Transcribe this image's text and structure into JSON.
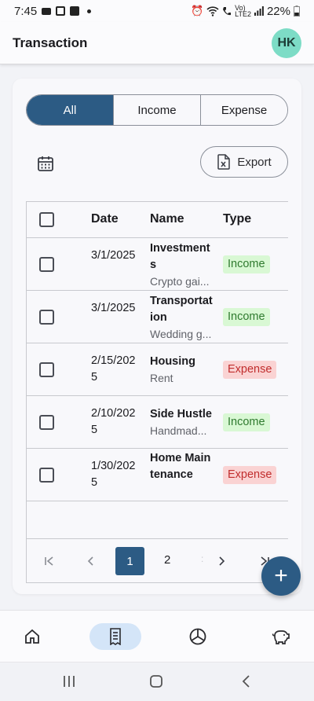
{
  "status": {
    "time": "7:45",
    "lte": "Vo)",
    "lte2": "LTE2",
    "battery": "22%"
  },
  "header": {
    "title": "Transaction",
    "avatar_initials": "HK"
  },
  "filter_tabs": [
    {
      "label": "All",
      "active": true
    },
    {
      "label": "Income",
      "active": false
    },
    {
      "label": "Expense",
      "active": false
    }
  ],
  "toolbar": {
    "calendar_icon": "calendar-icon",
    "export_label": "Export",
    "export_icon": "excel-file-icon"
  },
  "table": {
    "columns": [
      "Date",
      "Name",
      "Type"
    ],
    "rows": [
      {
        "date": "3/1/2025",
        "name": "Investments",
        "desc": "Crypto gai...",
        "type": "Income"
      },
      {
        "date": "3/1/2025",
        "name": "Transportation",
        "desc": "Wedding g...",
        "type": "Income"
      },
      {
        "date": "2/15/2025",
        "name": "Housing",
        "desc": "Rent",
        "type": "Expense"
      },
      {
        "date": "2/10/2025",
        "name": "Side Hustle",
        "desc": "Handmad...",
        "type": "Income"
      },
      {
        "date": "1/30/2025",
        "name": "Home Maintenance",
        "desc": "",
        "type": "Expense"
      }
    ]
  },
  "pagination": {
    "current": "1",
    "next_page": "2",
    "ellipsis": ":"
  },
  "fab": {
    "label": "+"
  },
  "bottom_nav": [
    {
      "name": "home-icon",
      "active": false
    },
    {
      "name": "receipt-icon",
      "active": true
    },
    {
      "name": "pie-chart-icon",
      "active": false
    },
    {
      "name": "piggy-bank-icon",
      "active": false
    }
  ],
  "colors": {
    "primary": "#2c5b84",
    "income_bg": "#d9f8d4",
    "income_fg": "#2f7a2f",
    "expense_bg": "#fad3d3",
    "expense_fg": "#c12e2e",
    "avatar": "#7ddcc6"
  }
}
